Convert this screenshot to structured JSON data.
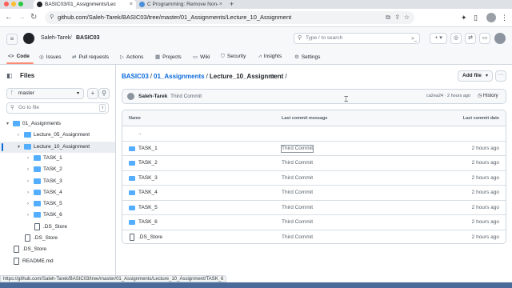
{
  "browser": {
    "tabs": [
      {
        "title": "BASIC03/01_Assignments/Lec",
        "active": true
      },
      {
        "title": "C Programming: Remove Non-",
        "active": false
      }
    ],
    "url": "github.com/Saleh-Tarek/BASIC03/tree/master/01_Assignments/Lecture_10_Assignment",
    "new_tab": "+"
  },
  "header": {
    "owner": "Saleh-Tarek",
    "separator": "/",
    "repo": "BASIC03",
    "search_placeholder": "Type / to search",
    "search_shortcut": ">_",
    "plus_label": "+ ▾"
  },
  "repo_nav": [
    {
      "label": "Code",
      "icon": "code-icon",
      "icon_glyph": "<>"
    },
    {
      "label": "Issues",
      "icon": "issues-icon",
      "icon_glyph": "◎"
    },
    {
      "label": "Pull requests",
      "icon": "pull-request-icon",
      "icon_glyph": "⇄"
    },
    {
      "label": "Actions",
      "icon": "actions-icon",
      "icon_glyph": "▷"
    },
    {
      "label": "Projects",
      "icon": "projects-icon",
      "icon_glyph": "▦"
    },
    {
      "label": "Wiki",
      "icon": "wiki-icon",
      "icon_glyph": "▭"
    },
    {
      "label": "Security",
      "icon": "shield-icon",
      "icon_glyph": "⛉"
    },
    {
      "label": "Insights",
      "icon": "graph-icon",
      "icon_glyph": "⩘"
    },
    {
      "label": "Settings",
      "icon": "gear-icon",
      "icon_glyph": "⚙"
    }
  ],
  "sidebar": {
    "title": "Files",
    "branch": "master",
    "goto_placeholder": "Go to file",
    "goto_shortcut": "t",
    "tree": [
      {
        "label": "01_Assignments",
        "type": "folder",
        "expanded": true,
        "depth": 0
      },
      {
        "label": "Lecture_05_Assignment",
        "type": "folder",
        "expanded": false,
        "depth": 1
      },
      {
        "label": "Lecture_10_Assignment",
        "type": "folder",
        "expanded": true,
        "depth": 1,
        "selected": true
      },
      {
        "label": "TASK_1",
        "type": "folder",
        "expanded": false,
        "depth": 2
      },
      {
        "label": "TASK_2",
        "type": "folder",
        "expanded": false,
        "depth": 2
      },
      {
        "label": "TASK_3",
        "type": "folder",
        "expanded": false,
        "depth": 2
      },
      {
        "label": "TASK_4",
        "type": "folder",
        "expanded": false,
        "depth": 2
      },
      {
        "label": "TASK_5",
        "type": "folder",
        "expanded": false,
        "depth": 2
      },
      {
        "label": "TASK_6",
        "type": "folder",
        "expanded": false,
        "depth": 2
      },
      {
        "label": ".DS_Store",
        "type": "file",
        "depth": 2
      },
      {
        "label": ".DS_Store",
        "type": "file",
        "depth": 1
      },
      {
        "label": ".DS_Store",
        "type": "file",
        "depth": 0
      },
      {
        "label": "README.md",
        "type": "file",
        "depth": 0
      }
    ]
  },
  "main": {
    "breadcrumb": {
      "repo": "BASIC03",
      "folder": "01_Assignments",
      "current": "Lecture_10_Assignment",
      "sep": "/"
    },
    "add_file_label": "Add file",
    "more_label": "···",
    "commit": {
      "author": "Saleh-Tarek",
      "message": "Third Commit",
      "meta": "ca2ea24 · 2 hours ago",
      "history_label": "History"
    },
    "table": {
      "headers": {
        "name": "Name",
        "message": "Last commit message",
        "date": "Last commit date"
      },
      "rows": [
        {
          "name": "..",
          "type": "folder",
          "message": "",
          "date": ""
        },
        {
          "name": "TASK_1",
          "type": "folder",
          "message": "Third Commit",
          "date": "2 hours ago",
          "highlight": true
        },
        {
          "name": "TASK_2",
          "type": "folder",
          "message": "Third Commit",
          "date": "2 hours ago"
        },
        {
          "name": "TASK_3",
          "type": "folder",
          "message": "Third Commit",
          "date": "2 hours ago"
        },
        {
          "name": "TASK_4",
          "type": "folder",
          "message": "Third Commit",
          "date": "2 hours ago"
        },
        {
          "name": "TASK_5",
          "type": "folder",
          "message": "Third Commit",
          "date": "2 hours ago"
        },
        {
          "name": "TASK_6",
          "type": "folder",
          "message": "Third Commit",
          "date": "2 hours ago"
        },
        {
          "name": ".DS_Store",
          "type": "file",
          "message": "Third Commit",
          "date": "2 hours ago"
        }
      ]
    }
  },
  "status_url": "https://github.com/Saleh-Tarek/BASIC03/tree/master/01_Assignments/Lecture_10_Assignment/TASK_6",
  "colors": {
    "accent": "#0969da",
    "folder": "#54aeff",
    "nav_underline": "#fd8c73"
  }
}
